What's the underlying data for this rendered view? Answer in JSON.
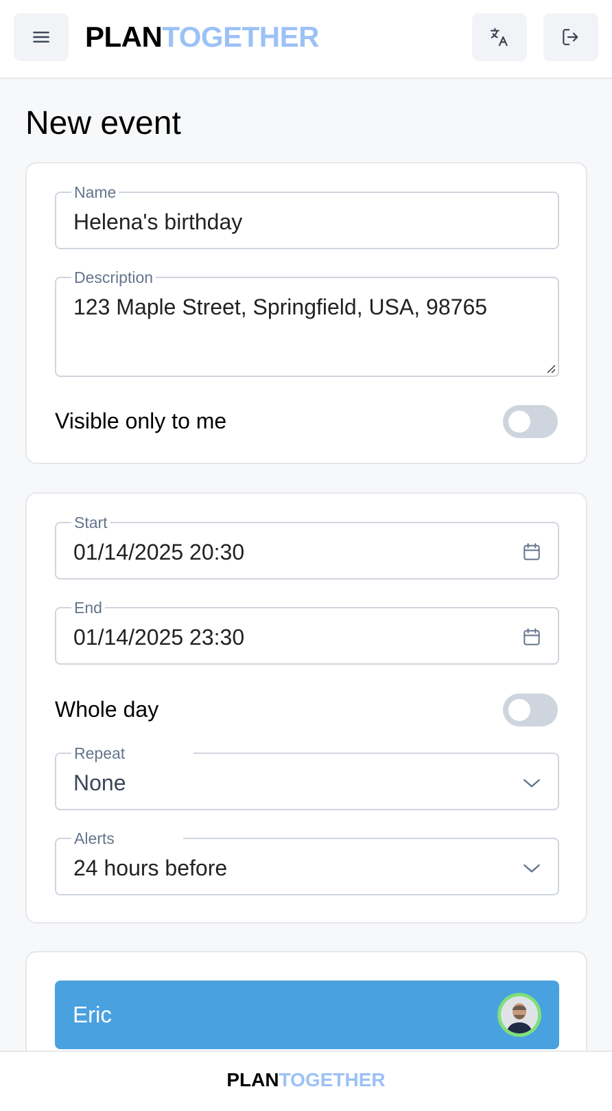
{
  "header": {
    "brand_part1": "PLAN",
    "brand_part2": "TOGETHER"
  },
  "page": {
    "title": "New event"
  },
  "details": {
    "name_label": "Name",
    "name_value": "Helena's birthday",
    "description_label": "Description",
    "description_value": "123 Maple Street, Springfield, USA, 98765",
    "visible_only_label": "Visible only to me",
    "visible_only_on": false
  },
  "schedule": {
    "start_label": "Start",
    "start_value": "01/14/2025 20:30",
    "end_label": "End",
    "end_value": "01/14/2025 23:30",
    "whole_day_label": "Whole day",
    "whole_day_on": false,
    "repeat_label": "Repeat",
    "repeat_value": "None",
    "alerts_label": "Alerts",
    "alerts_value": "24 hours before"
  },
  "participants": [
    {
      "name": "Eric"
    }
  ],
  "footer": {
    "brand_part1": "PLAN",
    "brand_part2": "TOGETHER"
  },
  "colors": {
    "brand_accent": "#9cc1f5",
    "participant_bg": "#4aa1e0",
    "avatar_ring": "#7fe07a",
    "toggle_off": "#cfd5de"
  }
}
